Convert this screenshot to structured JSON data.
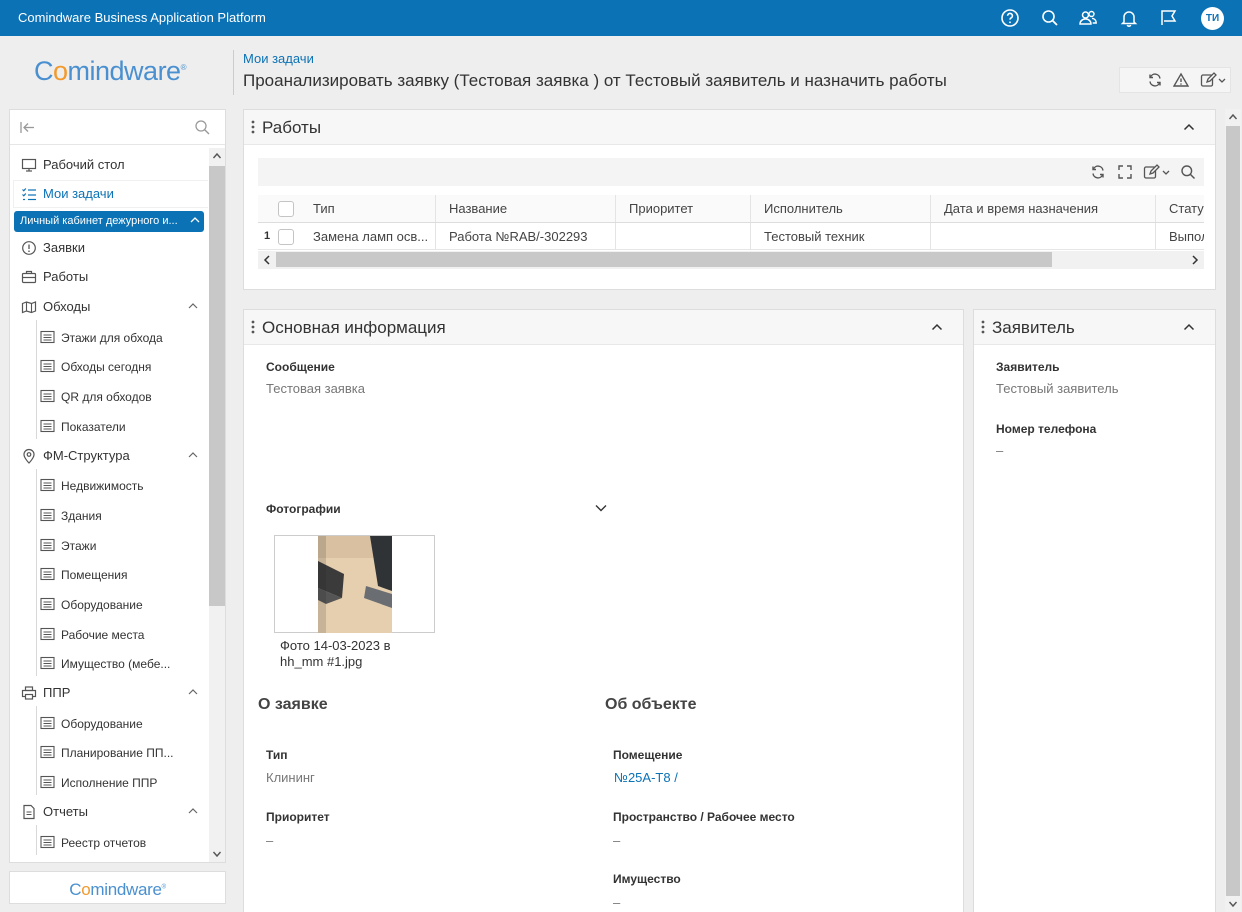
{
  "app": {
    "title": "Comindware Business Application Platform",
    "avatar_initials": "ТИ"
  },
  "topbar_icons": [
    "help-icon",
    "search-icon",
    "users-icon",
    "bell-icon",
    "flag-icon"
  ],
  "logo": {
    "prefix": "C",
    "accent": "o",
    "suffix": "mindware",
    "mark": "®"
  },
  "header": {
    "breadcrumb": "Мои задачи",
    "title": "Проанализировать заявку (Тестовая заявка ) от Тестовый заявитель и назначить работы",
    "tools": [
      "refresh-icon",
      "warning-icon",
      "edit-icon"
    ]
  },
  "sidebar": {
    "items": [
      {
        "label": "Рабочий стол",
        "icon": "desktop-icon"
      },
      {
        "label": "Мои задачи",
        "icon": "tasks-icon"
      },
      {
        "label": "Личный кабинет дежурного и..."
      },
      {
        "label": "Заявки",
        "icon": "alert-circle-icon"
      },
      {
        "label": "Работы",
        "icon": "briefcase-icon"
      },
      {
        "label": "Обходы",
        "icon": "map-icon"
      },
      {
        "label": "Этажи для обхода"
      },
      {
        "label": "Обходы сегодня"
      },
      {
        "label": "QR для обходов"
      },
      {
        "label": "Показатели"
      },
      {
        "label": "ФМ-Структура",
        "icon": "pin-icon"
      },
      {
        "label": "Недвижимость"
      },
      {
        "label": "Здания"
      },
      {
        "label": "Этажи"
      },
      {
        "label": "Помещения"
      },
      {
        "label": "Оборудование"
      },
      {
        "label": "Рабочие места"
      },
      {
        "label": "Имущество (мебе..."
      },
      {
        "label": "ППР",
        "icon": "printer-icon"
      },
      {
        "label": "Оборудование"
      },
      {
        "label": "Планирование ПП..."
      },
      {
        "label": "Исполнение ППР"
      },
      {
        "label": "Отчеты",
        "icon": "document-icon"
      },
      {
        "label": "Реестр отчетов"
      }
    ]
  },
  "works": {
    "title": "Работы",
    "columns": [
      "Тип",
      "Название",
      "Приоритет",
      "Исполнитель",
      "Дата и время назначения",
      "Статус"
    ],
    "row": {
      "num": "1",
      "cells": [
        "Замена ламп осв...",
        "Работа №RAB/-302293",
        "",
        "Тестовый техник",
        "",
        "Выполнено"
      ]
    }
  },
  "info": {
    "title": "Основная информация",
    "message_label": "Сообщение",
    "message_value": "Тестовая заявка",
    "photos_label": "Фотографии",
    "photo_caption": "Фото 14-03-2023 в hh_mm #1.jpg",
    "about_request": "О заявке",
    "about_object": "Об объекте",
    "type_label": "Тип",
    "type_value": "Клининг",
    "priority_label": "Приоритет",
    "priority_value": "–",
    "room_label": "Помещение",
    "room_value": "№25А-Т8 /",
    "space_label": "Пространство / Рабочее место",
    "space_value": "–",
    "property_label": "Имущество",
    "property_value": "–"
  },
  "applicant": {
    "title": "Заявитель",
    "applicant_label": "Заявитель",
    "applicant_value": "Тестовый заявитель",
    "phone_label": "Номер телефона",
    "phone_value": "–"
  },
  "colors": {
    "brand": "#0b72b5",
    "logo_blue": "#4a90d0",
    "logo_orange": "#f29a2e"
  }
}
